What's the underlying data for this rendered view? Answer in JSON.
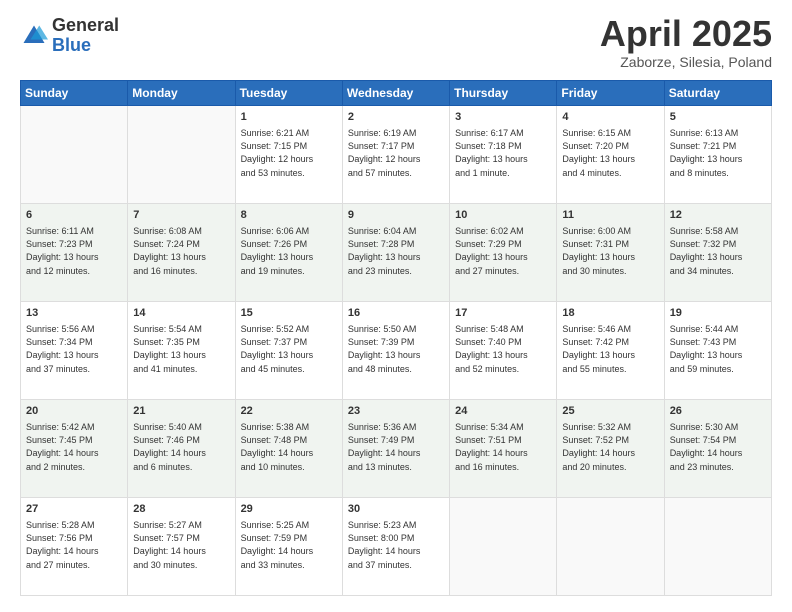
{
  "header": {
    "logo_general": "General",
    "logo_blue": "Blue",
    "title": "April 2025",
    "location": "Zaborze, Silesia, Poland"
  },
  "days_of_week": [
    "Sunday",
    "Monday",
    "Tuesday",
    "Wednesday",
    "Thursday",
    "Friday",
    "Saturday"
  ],
  "weeks": [
    [
      {
        "day": "",
        "info": ""
      },
      {
        "day": "",
        "info": ""
      },
      {
        "day": "1",
        "info": "Sunrise: 6:21 AM\nSunset: 7:15 PM\nDaylight: 12 hours\nand 53 minutes."
      },
      {
        "day": "2",
        "info": "Sunrise: 6:19 AM\nSunset: 7:17 PM\nDaylight: 12 hours\nand 57 minutes."
      },
      {
        "day": "3",
        "info": "Sunrise: 6:17 AM\nSunset: 7:18 PM\nDaylight: 13 hours\nand 1 minute."
      },
      {
        "day": "4",
        "info": "Sunrise: 6:15 AM\nSunset: 7:20 PM\nDaylight: 13 hours\nand 4 minutes."
      },
      {
        "day": "5",
        "info": "Sunrise: 6:13 AM\nSunset: 7:21 PM\nDaylight: 13 hours\nand 8 minutes."
      }
    ],
    [
      {
        "day": "6",
        "info": "Sunrise: 6:11 AM\nSunset: 7:23 PM\nDaylight: 13 hours\nand 12 minutes."
      },
      {
        "day": "7",
        "info": "Sunrise: 6:08 AM\nSunset: 7:24 PM\nDaylight: 13 hours\nand 16 minutes."
      },
      {
        "day": "8",
        "info": "Sunrise: 6:06 AM\nSunset: 7:26 PM\nDaylight: 13 hours\nand 19 minutes."
      },
      {
        "day": "9",
        "info": "Sunrise: 6:04 AM\nSunset: 7:28 PM\nDaylight: 13 hours\nand 23 minutes."
      },
      {
        "day": "10",
        "info": "Sunrise: 6:02 AM\nSunset: 7:29 PM\nDaylight: 13 hours\nand 27 minutes."
      },
      {
        "day": "11",
        "info": "Sunrise: 6:00 AM\nSunset: 7:31 PM\nDaylight: 13 hours\nand 30 minutes."
      },
      {
        "day": "12",
        "info": "Sunrise: 5:58 AM\nSunset: 7:32 PM\nDaylight: 13 hours\nand 34 minutes."
      }
    ],
    [
      {
        "day": "13",
        "info": "Sunrise: 5:56 AM\nSunset: 7:34 PM\nDaylight: 13 hours\nand 37 minutes."
      },
      {
        "day": "14",
        "info": "Sunrise: 5:54 AM\nSunset: 7:35 PM\nDaylight: 13 hours\nand 41 minutes."
      },
      {
        "day": "15",
        "info": "Sunrise: 5:52 AM\nSunset: 7:37 PM\nDaylight: 13 hours\nand 45 minutes."
      },
      {
        "day": "16",
        "info": "Sunrise: 5:50 AM\nSunset: 7:39 PM\nDaylight: 13 hours\nand 48 minutes."
      },
      {
        "day": "17",
        "info": "Sunrise: 5:48 AM\nSunset: 7:40 PM\nDaylight: 13 hours\nand 52 minutes."
      },
      {
        "day": "18",
        "info": "Sunrise: 5:46 AM\nSunset: 7:42 PM\nDaylight: 13 hours\nand 55 minutes."
      },
      {
        "day": "19",
        "info": "Sunrise: 5:44 AM\nSunset: 7:43 PM\nDaylight: 13 hours\nand 59 minutes."
      }
    ],
    [
      {
        "day": "20",
        "info": "Sunrise: 5:42 AM\nSunset: 7:45 PM\nDaylight: 14 hours\nand 2 minutes."
      },
      {
        "day": "21",
        "info": "Sunrise: 5:40 AM\nSunset: 7:46 PM\nDaylight: 14 hours\nand 6 minutes."
      },
      {
        "day": "22",
        "info": "Sunrise: 5:38 AM\nSunset: 7:48 PM\nDaylight: 14 hours\nand 10 minutes."
      },
      {
        "day": "23",
        "info": "Sunrise: 5:36 AM\nSunset: 7:49 PM\nDaylight: 14 hours\nand 13 minutes."
      },
      {
        "day": "24",
        "info": "Sunrise: 5:34 AM\nSunset: 7:51 PM\nDaylight: 14 hours\nand 16 minutes."
      },
      {
        "day": "25",
        "info": "Sunrise: 5:32 AM\nSunset: 7:52 PM\nDaylight: 14 hours\nand 20 minutes."
      },
      {
        "day": "26",
        "info": "Sunrise: 5:30 AM\nSunset: 7:54 PM\nDaylight: 14 hours\nand 23 minutes."
      }
    ],
    [
      {
        "day": "27",
        "info": "Sunrise: 5:28 AM\nSunset: 7:56 PM\nDaylight: 14 hours\nand 27 minutes."
      },
      {
        "day": "28",
        "info": "Sunrise: 5:27 AM\nSunset: 7:57 PM\nDaylight: 14 hours\nand 30 minutes."
      },
      {
        "day": "29",
        "info": "Sunrise: 5:25 AM\nSunset: 7:59 PM\nDaylight: 14 hours\nand 33 minutes."
      },
      {
        "day": "30",
        "info": "Sunrise: 5:23 AM\nSunset: 8:00 PM\nDaylight: 14 hours\nand 37 minutes."
      },
      {
        "day": "",
        "info": ""
      },
      {
        "day": "",
        "info": ""
      },
      {
        "day": "",
        "info": ""
      }
    ]
  ]
}
